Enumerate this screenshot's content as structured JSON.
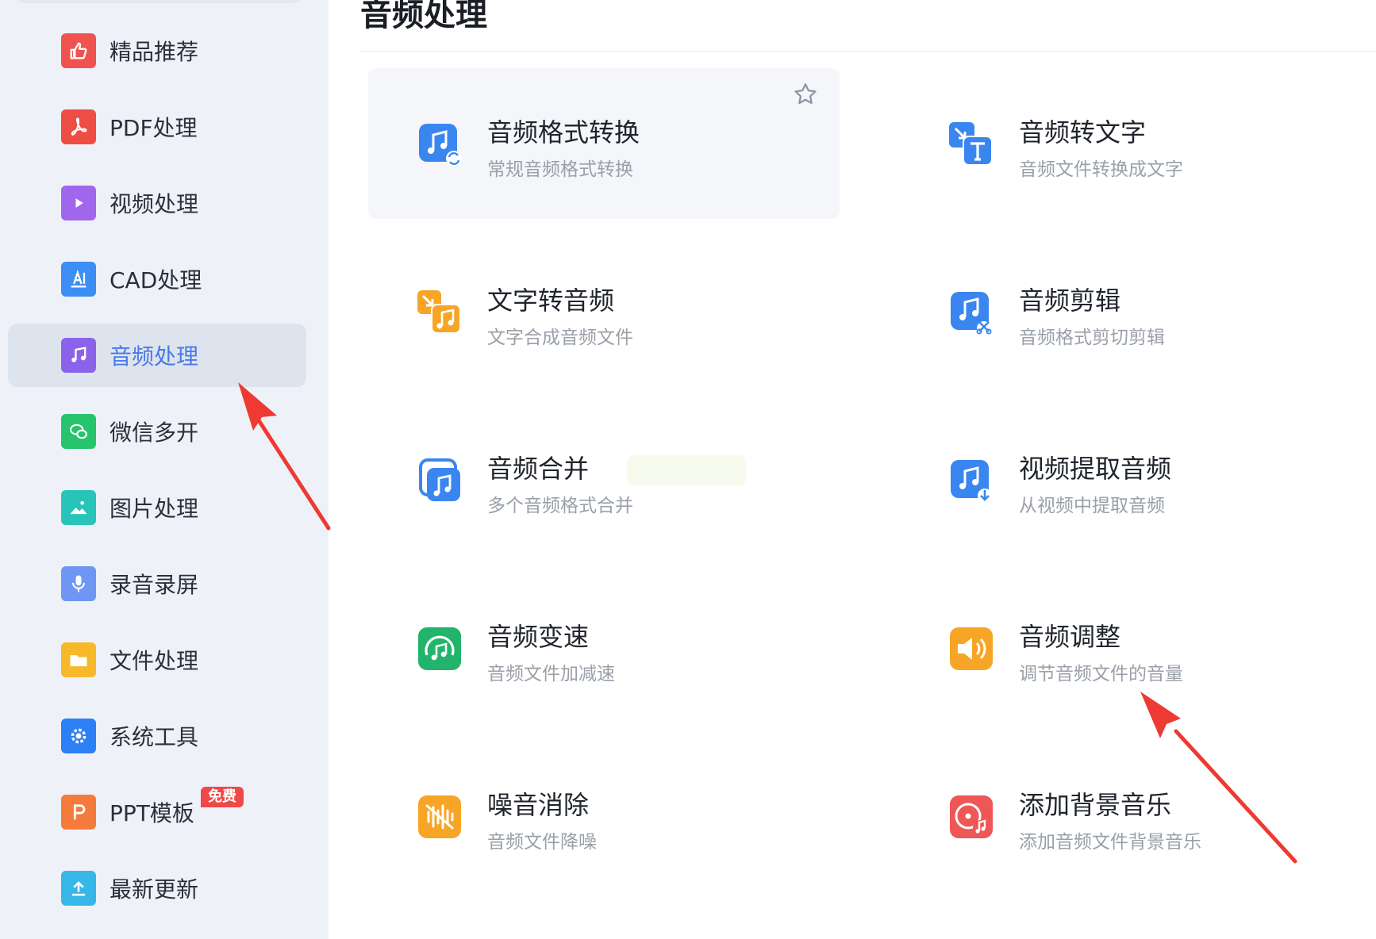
{
  "sidebar": {
    "items": [
      {
        "label": "精品推荐",
        "icon": "thumbs-up-icon",
        "color": "#f0524f"
      },
      {
        "label": "PDF处理",
        "icon": "pdf-icon",
        "color": "#ee4d44"
      },
      {
        "label": "视频处理",
        "icon": "play-icon",
        "color": "#a067ec"
      },
      {
        "label": "CAD处理",
        "icon": "cad-icon",
        "color": "#3c8ef5"
      },
      {
        "label": "音频处理",
        "icon": "music-note-icon",
        "color": "#8b63ea",
        "active": true
      },
      {
        "label": "微信多开",
        "icon": "wechat-icon",
        "color": "#27c36d"
      },
      {
        "label": "图片处理",
        "icon": "image-icon",
        "color": "#28c4b7"
      },
      {
        "label": "录音录屏",
        "icon": "microphone-icon",
        "color": "#6f96f2"
      },
      {
        "label": "文件处理",
        "icon": "folder-icon",
        "color": "#f7b82a"
      },
      {
        "label": "系统工具",
        "icon": "gear-icon",
        "color": "#2d7ff5"
      },
      {
        "label": "PPT模板",
        "icon": "ppt-icon",
        "color": "#f57b3c",
        "badge": "免费"
      },
      {
        "label": "最新更新",
        "icon": "upload-icon",
        "color": "#36b7e8"
      }
    ]
  },
  "main": {
    "title": "音频处理",
    "tools": [
      {
        "title": "音频格式转换",
        "desc": "常规音频格式转换",
        "icon": "audio-convert-icon",
        "color": "#3a86f0"
      },
      {
        "title": "音频转文字",
        "desc": "音频文件转换成文字",
        "icon": "audio-to-text-icon",
        "color": "#3a86f0"
      },
      {
        "title": "文字转音频",
        "desc": "文字合成音频文件",
        "icon": "text-to-audio-icon",
        "color": "#f7a526"
      },
      {
        "title": "音频剪辑",
        "desc": "音频格式剪切剪辑",
        "icon": "audio-cut-icon",
        "color": "#3a86f0"
      },
      {
        "title": "音频合并",
        "desc": "多个音频格式合并",
        "icon": "audio-merge-icon",
        "color": "#3a86f0"
      },
      {
        "title": "视频提取音频",
        "desc": "从视频中提取音频",
        "icon": "extract-audio-icon",
        "color": "#3a86f0"
      },
      {
        "title": "音频变速",
        "desc": "音频文件加减速",
        "icon": "audio-speed-icon",
        "color": "#22b46c"
      },
      {
        "title": "音频调整",
        "desc": "调节音频文件的音量",
        "icon": "volume-icon",
        "color": "#f7a526"
      },
      {
        "title": "噪音消除",
        "desc": "音频文件降噪",
        "icon": "noise-reduction-icon",
        "color": "#f7a526"
      },
      {
        "title": "添加背景音乐",
        "desc": "添加音频文件背景音乐",
        "icon": "background-music-icon",
        "color": "#ef5656"
      }
    ]
  },
  "colors": {
    "accent": "#4a78e8",
    "annotation_arrow": "#ee3a32"
  }
}
